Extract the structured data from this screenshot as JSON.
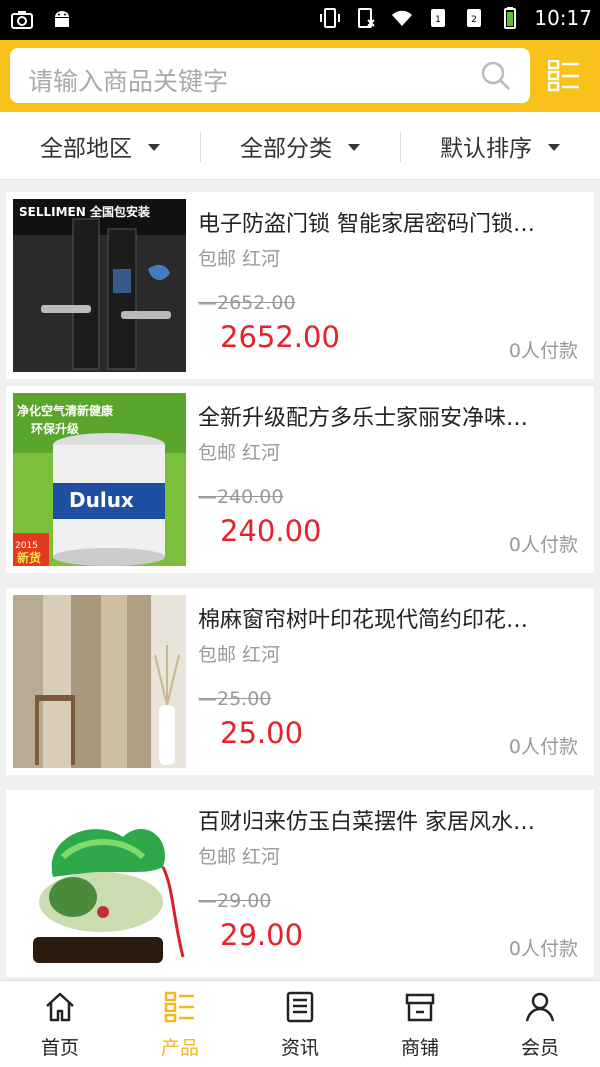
{
  "status_bar": {
    "time": "10:17"
  },
  "search": {
    "placeholder": "请输入商品关键字"
  },
  "filters": [
    {
      "label": "全部地区"
    },
    {
      "label": "全部分类"
    },
    {
      "label": "默认排序"
    }
  ],
  "products": [
    {
      "title": "电子防盗门锁 智能家居密码门锁…",
      "shipping": "包邮",
      "location": "红河",
      "original_price": "2652.00",
      "price": "2652.00",
      "paid": "0人付款",
      "image_text": "SELLIMEN 全国包安装"
    },
    {
      "title": "全新升级配方多乐士家丽安净味…",
      "shipping": "包邮",
      "location": "红河",
      "original_price": "240.00",
      "price": "240.00",
      "paid": "0人付款",
      "image_text": "净化空气清新健康 环保升级 Dulux 2015 新货"
    },
    {
      "title": "棉麻窗帘树叶印花现代简约印花…",
      "shipping": "包邮",
      "location": "红河",
      "original_price": "25.00",
      "price": "25.00",
      "paid": "0人付款"
    },
    {
      "title": "百财归来仿玉白菜摆件 家居风水…",
      "shipping": "包邮",
      "location": "红河",
      "original_price": "29.00",
      "price": "29.00",
      "paid": "0人付款"
    }
  ],
  "tabs": [
    {
      "label": "首页",
      "icon": "home-icon"
    },
    {
      "label": "产品",
      "icon": "product-list-icon",
      "active": true
    },
    {
      "label": "资讯",
      "icon": "news-icon"
    },
    {
      "label": "商铺",
      "icon": "shop-icon"
    },
    {
      "label": "会员",
      "icon": "user-icon"
    }
  ],
  "colors": {
    "accent": "#f8c21a",
    "price": "#e8202a",
    "active_tab": "#f3b81c"
  }
}
